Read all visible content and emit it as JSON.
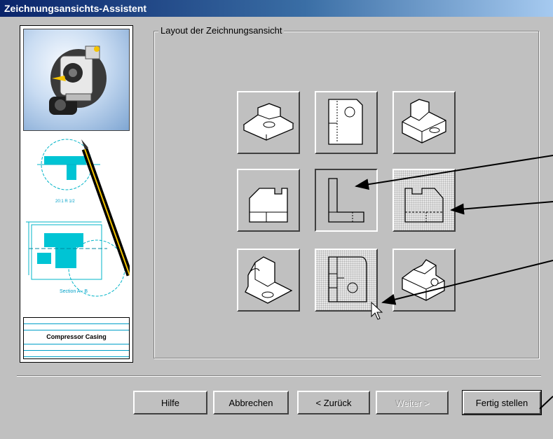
{
  "window": {
    "title": "Zeichnungsansichts-Assistent"
  },
  "preview": {
    "title_block_name": "Compressor Casing",
    "section_label": "Section A - B",
    "detail_label": "20:1 R 1/2"
  },
  "group": {
    "label": "Layout der Zeichnungsansicht"
  },
  "views": [
    {
      "id": "iso-top-left",
      "state": "normal"
    },
    {
      "id": "top",
      "state": "normal"
    },
    {
      "id": "iso-top-right",
      "state": "normal"
    },
    {
      "id": "left",
      "state": "normal"
    },
    {
      "id": "front",
      "state": "pressed"
    },
    {
      "id": "right",
      "state": "selected"
    },
    {
      "id": "iso-bottom-left",
      "state": "normal"
    },
    {
      "id": "bottom",
      "state": "selected"
    },
    {
      "id": "iso-bottom-right",
      "state": "normal"
    }
  ],
  "buttons": {
    "help": "Hilfe",
    "cancel": "Abbrechen",
    "back": "< Zurück",
    "next": "Weiter >",
    "finish": "Fertig stellen"
  },
  "colors": {
    "titlebar_start": "#0a246a",
    "titlebar_end": "#a6caf0",
    "dialog_bg": "#c0c0c0",
    "drawing_accent": "#00b4c8"
  }
}
